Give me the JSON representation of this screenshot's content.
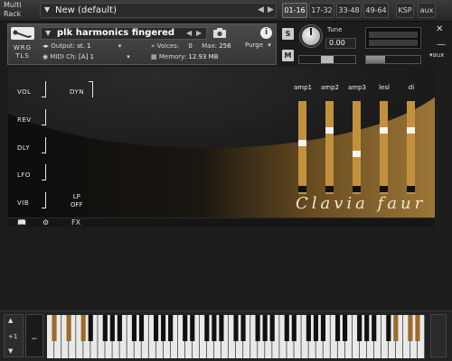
{
  "rack": {
    "label_line1": "Multi",
    "label_line2": "Rack",
    "preset_name": "New (default)",
    "pages": [
      "01-16",
      "17-32",
      "33-48",
      "49-64",
      "KSP",
      "aux"
    ]
  },
  "instrument": {
    "tools_line1": "WRG",
    "tools_line2": "TLS",
    "name": "plk harmonics fingered",
    "output_label": "Output:",
    "output_value": "st. 1",
    "voices_label": "Voices:",
    "voices_value": "0",
    "max_label": "Max:",
    "max_value": "256",
    "purge_label": "Purge",
    "midi_label": "MIDI Ch:",
    "midi_value": "[A]  1",
    "memory_label": "Memory:",
    "memory_value": "12.93 MB"
  },
  "tune": {
    "label": "Tune",
    "value": "0.00",
    "solo": "S",
    "mute": "M",
    "volume_level": 0.35
  },
  "panel": {
    "left_labels": [
      "VOL",
      "REV",
      "DLY",
      "LFO",
      "VIB"
    ],
    "dyn_label": "DYN",
    "lp_label": "LP",
    "off_label": "OFF",
    "columns": [
      {
        "label": "amp1",
        "handle": 0.45
      },
      {
        "label": "amp2",
        "handle": 0.3
      },
      {
        "label": "amp3",
        "handle": 0.57
      },
      {
        "label": "lesl",
        "handle": 0.3
      },
      {
        "label": "di",
        "handle": 0.3
      }
    ],
    "logo": "Clavia faur"
  },
  "footer": {
    "fx_label": "FX"
  },
  "keyboard": {
    "plus_label": "+1",
    "minus_label": "−"
  },
  "colors": {
    "accent_bar": "#c2913e",
    "panel_gold": "#9b7637"
  }
}
